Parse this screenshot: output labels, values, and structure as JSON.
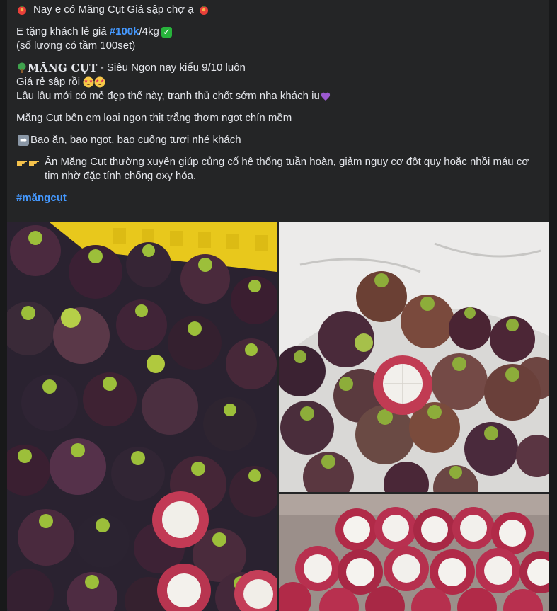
{
  "post": {
    "line1": "Nay e có Măng Cụt Giá sập chợ ạ",
    "line2_prefix": "E tặng khách lẻ giá ",
    "line2_price": "#100k",
    "line2_suffix": "/4kg",
    "line3": "(số lượng có tầm 100set)",
    "line4_brand": "MĂNG CỤT",
    "line4_rest": " - Siêu Ngon nay kiểu 9/10 luôn",
    "line5": "Giá rẻ sập rồi",
    "line6": "Lâu lâu mới có mẻ đẹp thế này, tranh thủ chốt sớm nha khách iu",
    "line7": "Măng Cụt bên em loại ngon thịt trắng thơm ngọt chín mềm",
    "line8": "Bao ăn, bao ngọt, bao cuống tươi nhé khách",
    "line9": "Ăn Măng Cụt thường xuyên giúp củng cố hệ thống tuần hoàn, giảm nguy cơ đột quỵ hoặc nhồi máu cơ tim nhờ đặc tính chống oxy hóa.",
    "hashtag": "#măngcụt"
  },
  "colors": {
    "background": "#18191a",
    "card": "#242526",
    "text": "#e4e6eb",
    "link": "#4599ff"
  },
  "icons": [
    "fruit-icon",
    "green-check-icon",
    "tree-icon",
    "star-eyes-emoji",
    "purple-heart-icon",
    "right-arrow-icon",
    "pointing-hands-icon"
  ],
  "photos": [
    {
      "name": "mangosteen-crate-photo"
    },
    {
      "name": "mangosteen-opened-photo"
    },
    {
      "name": "mangosteen-peeled-photo"
    }
  ]
}
